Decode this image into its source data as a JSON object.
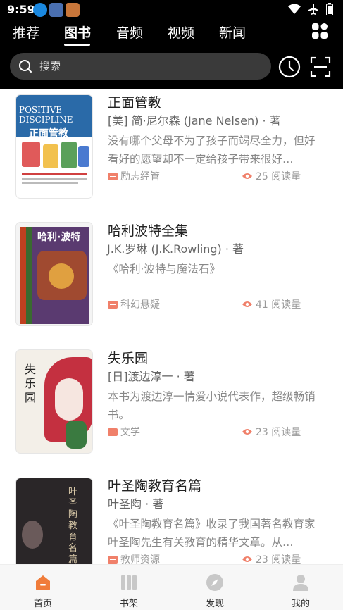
{
  "status_bar": {
    "time": "9:59"
  },
  "tabs": [
    {
      "label": "推荐"
    },
    {
      "label": "图书"
    },
    {
      "label": "音频"
    },
    {
      "label": "视频"
    },
    {
      "label": "新闻"
    }
  ],
  "active_tab": "图书",
  "search": {
    "placeholder": "搜索"
  },
  "books": [
    {
      "title": "正面管教",
      "author": "[美] 简·尼尔森 (Jane Nelsen) · 著",
      "description": "没有哪个父母不为了孩子而竭尽全力，但好看好的愿望却不一定给孩子带来很好…",
      "category": "励志经管",
      "reads": "25 阅读量",
      "cover_text": "正面管教"
    },
    {
      "title": "哈利波特全集",
      "author": "J.K.罗琳 (J.K.Rowling) · 著",
      "description": "《哈利·波特与魔法石》",
      "category": "科幻悬疑",
      "reads": "41 阅读量",
      "cover_text": "哈利·波特"
    },
    {
      "title": "失乐园",
      "author": "[日]渡边淳一 · 著",
      "description": "本书为渡边淳一情爱小说代表作，超级畅销书。",
      "category": "文学",
      "reads": "23 阅读量",
      "cover_text": "失乐园"
    },
    {
      "title": "叶圣陶教育名篇",
      "author": "叶圣陶 · 著",
      "description": "《叶圣陶教育名篇》收录了我国著名教育家叶圣陶先生有关教育的精华文章。从…",
      "category": "教师资源",
      "reads": "23 阅读量",
      "cover_text": "叶圣陶教育名篇"
    }
  ],
  "bottom_nav": [
    {
      "label": "首页",
      "icon": "home-icon",
      "active": true
    },
    {
      "label": "书架",
      "icon": "bookshelf-icon",
      "active": false
    },
    {
      "label": "发现",
      "icon": "compass-icon",
      "active": false
    },
    {
      "label": "我的",
      "icon": "user-icon",
      "active": false
    }
  ],
  "colors": {
    "accent": "#f0806a",
    "active_nav": "#f07c3a",
    "header_bg": "#000000"
  }
}
